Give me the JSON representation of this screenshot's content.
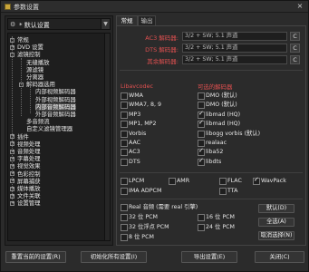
{
  "window": {
    "title": "参数设置",
    "close": "×"
  },
  "profile": {
    "value": "* 默认设置"
  },
  "tree": [
    {
      "label": "常规",
      "box": "-"
    },
    {
      "label": "DVD 设置",
      "box": "+"
    },
    {
      "label": "滤镜控制",
      "box": "-"
    },
    {
      "label": "无缝播放"
    },
    {
      "label": "源滤镜"
    },
    {
      "label": "分离器"
    },
    {
      "label": "解码器选用",
      "box": "-"
    },
    {
      "label": "内部视频解码器"
    },
    {
      "label": "外部视频解码器"
    },
    {
      "label": "内部音频解码器"
    },
    {
      "label": "外部音频解码器"
    },
    {
      "label": "多音频流"
    },
    {
      "label": "自定义滤镜管理器"
    },
    {
      "label": "插件",
      "box": "+"
    },
    {
      "label": "视频处理",
      "box": "+"
    },
    {
      "label": "音频处理",
      "box": "+"
    },
    {
      "label": "字幕处理",
      "box": "+"
    },
    {
      "label": "视觉效果",
      "box": "+"
    },
    {
      "label": "色彩控制",
      "box": "+"
    },
    {
      "label": "屏幕捕获",
      "box": "+"
    },
    {
      "label": "媒体播放",
      "box": "+"
    },
    {
      "label": "文件关联",
      "box": "+"
    },
    {
      "label": "设置管理",
      "box": "+"
    }
  ],
  "tabs": [
    "常规",
    "输出"
  ],
  "decoders": [
    {
      "label": "AC3 解码器:",
      "value": "3/2 + SW; 5.1 声道",
      "btn": "C"
    },
    {
      "label": "DTS 解码器:",
      "value": "3/2 + SW; 5.1 声道",
      "btn": "C"
    },
    {
      "label": "其余解码器:",
      "value": "3/2 + SW; 5.1 声道",
      "btn": "C"
    }
  ],
  "headers": {
    "libav": "Libavcodec",
    "optional": "可选的解码器"
  },
  "libav": [
    {
      "label": "WMA",
      "on": false
    },
    {
      "label": "WMA7, 8, 9",
      "on": false
    },
    {
      "label": "MP3",
      "on": false
    },
    {
      "label": "MP1, MP2",
      "on": false
    },
    {
      "label": "Vorbis",
      "on": false
    },
    {
      "label": "AAC",
      "on": false
    },
    {
      "label": "AC3",
      "on": false
    },
    {
      "label": "DTS",
      "on": false
    }
  ],
  "optional": [
    {
      "label": "DMO (默认)",
      "on": false
    },
    {
      "label": "DMO (默认)",
      "on": false
    },
    {
      "label": "libmad (HQ)",
      "on": true
    },
    {
      "label": "libmad (HQ)",
      "on": true
    },
    {
      "label": "libogg vorbis (默认)",
      "on": false
    },
    {
      "label": "realaac",
      "on": false
    },
    {
      "label": "liba52",
      "on": true
    },
    {
      "label": "libdts",
      "on": true
    }
  ],
  "misc": [
    {
      "label": "LPCM",
      "on": false
    },
    {
      "label": "AMR",
      "on": false
    },
    {
      "label": "FLAC",
      "on": false
    },
    {
      "label": "WavPack",
      "on": true
    },
    {
      "label": "IMA ADPCM",
      "on": false
    },
    {
      "label": "TTA",
      "on": false
    }
  ],
  "raw": [
    {
      "label": "Real 音频 (需要 real 引擎)",
      "on": false
    },
    {
      "label": "32 位 PCM",
      "on": false
    },
    {
      "label": "16 位 PCM",
      "on": false
    },
    {
      "label": "32 位浮点 PCM",
      "on": false
    },
    {
      "label": "24 位 PCM",
      "on": false
    },
    {
      "label": "8 位 PCM",
      "on": false
    }
  ],
  "side_buttons": [
    "默认(D)",
    "全选(A)",
    "取消选择(N)"
  ],
  "bottom_buttons": [
    "重置当前的设置(R)",
    "初始化所有设置(I)",
    "导出设置(E)",
    "关闭(C)"
  ]
}
